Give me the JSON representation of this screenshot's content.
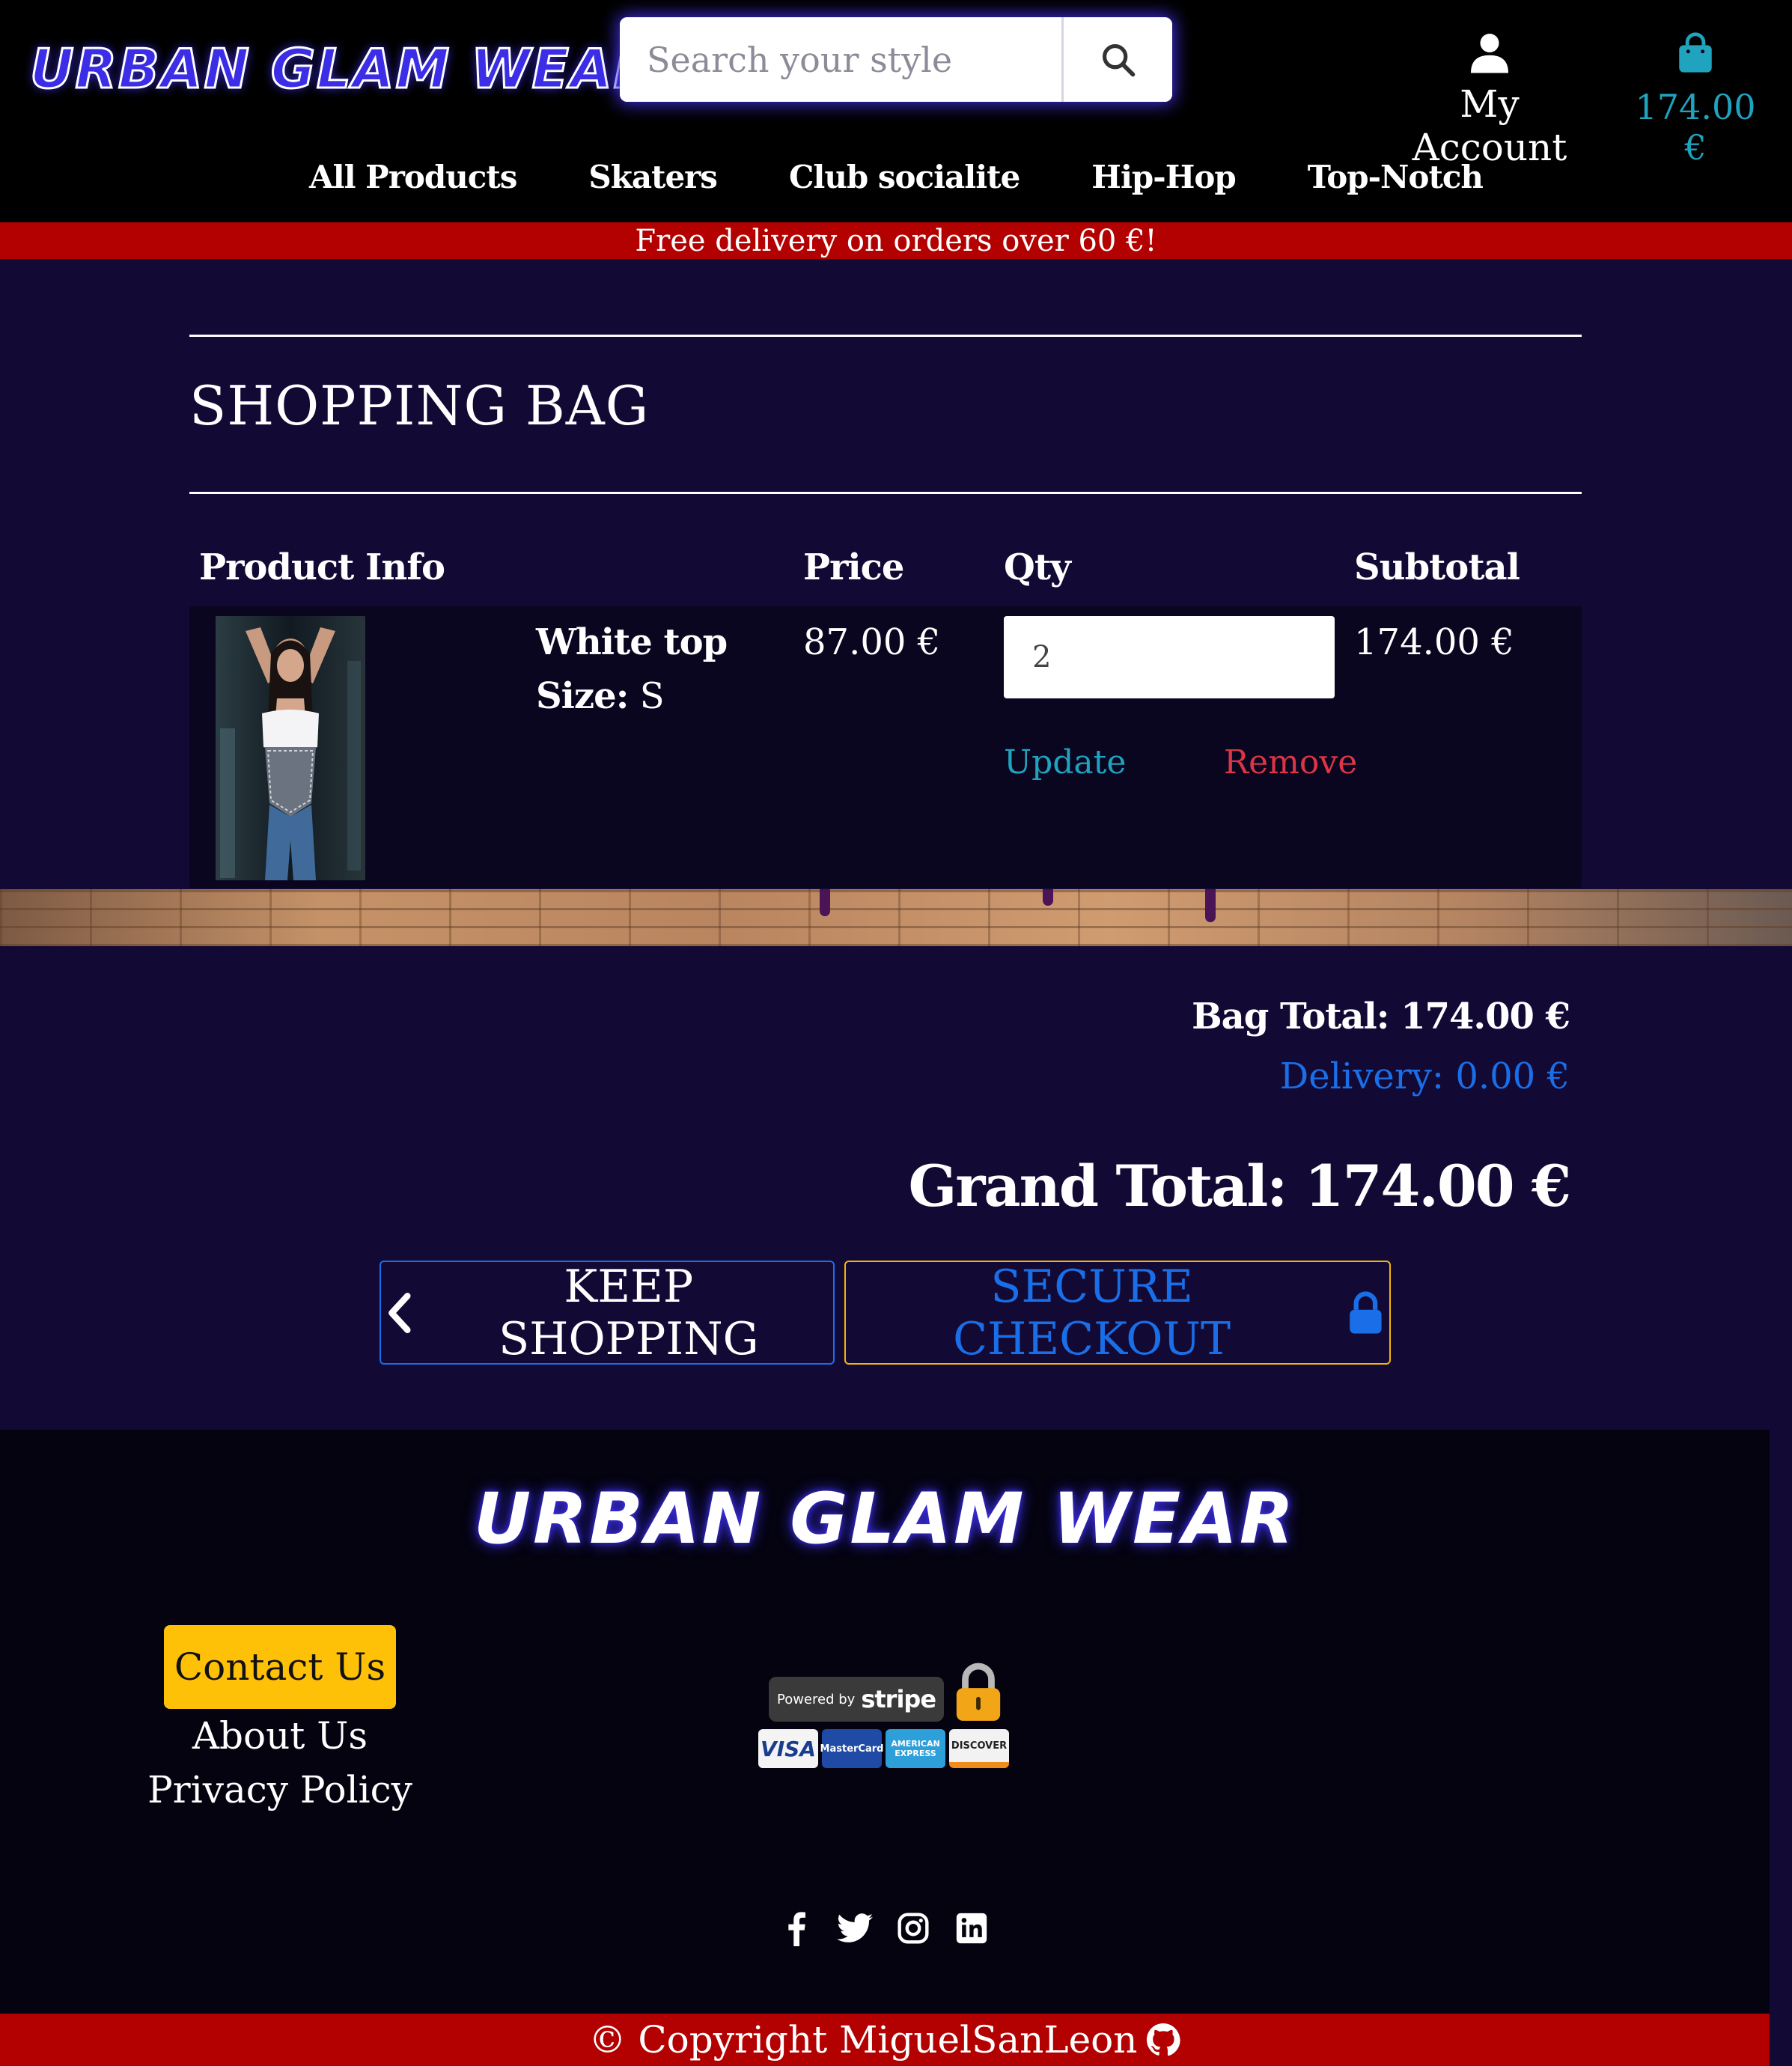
{
  "header": {
    "logo": "URBAN GLAM WEAR",
    "search": {
      "placeholder": "Search your style"
    },
    "account_label": "My Account",
    "bag_total": "174.00 €"
  },
  "nav": {
    "items": [
      {
        "label": "All Products"
      },
      {
        "label": "Skaters"
      },
      {
        "label": "Club socialite"
      },
      {
        "label": "Hip-Hop"
      },
      {
        "label": "Top-Notch"
      }
    ]
  },
  "banner": {
    "text": "Free delivery on orders over 60 €!"
  },
  "bag": {
    "title": "SHOPPING BAG",
    "columns": {
      "product_info": "Product Info",
      "price": "Price",
      "qty": "Qty",
      "subtotal": "Subtotal"
    },
    "items": [
      {
        "name": "White top",
        "size_label": "Size:",
        "size": "S",
        "price": "87.00 €",
        "qty": "2",
        "subtotal": "174.00 €",
        "update_label": "Update",
        "remove_label": "Remove"
      }
    ]
  },
  "totals": {
    "bag_total": "Bag Total: 174.00 €",
    "delivery": "Delivery: 0.00 €",
    "grand_total": "Grand Total: 174.00 €"
  },
  "actions": {
    "keep_shopping": "KEEP SHOPPING",
    "secure_checkout": "SECURE CHECKOUT"
  },
  "footer": {
    "logo": "URBAN GLAM WEAR",
    "contact": "Contact Us",
    "about": "About Us",
    "privacy": "Privacy Policy",
    "stripe": {
      "powered_by": "Powered by",
      "brand": "stripe"
    },
    "cards": [
      "VISA",
      "MasterCard",
      "AMERICAN EXPRESS",
      "DISCOVER"
    ],
    "social": [
      "facebook-icon",
      "twitter-icon",
      "instagram-icon",
      "linkedin-icon"
    ],
    "copyright": "© Copyright MiguelSanLeon"
  },
  "colors": {
    "page_bg": "#120a35",
    "header_bg": "#000000",
    "banner_red": "#b30000",
    "accent_teal": "#1fa3bf",
    "accent_blue": "#1a6ee8",
    "remove_red": "#dc3545",
    "contact_yellow": "#ffc107"
  }
}
